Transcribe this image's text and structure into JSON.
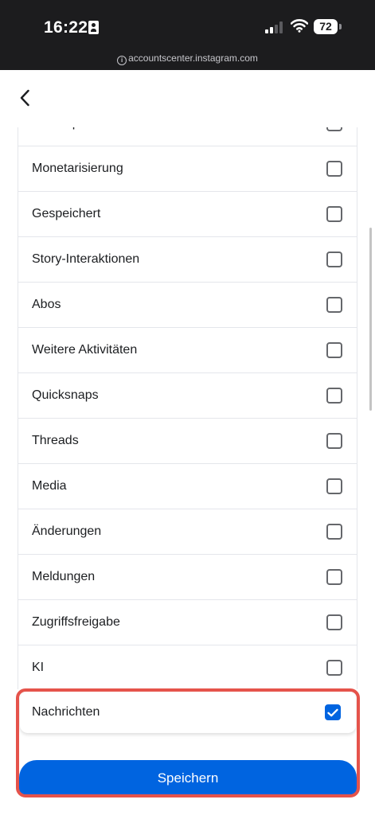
{
  "status_bar": {
    "time": "16:22",
    "battery": "72",
    "url": "accountscenter.instagram.com"
  },
  "list": {
    "items": [
      {
        "label": "Meta Spark",
        "checked": false
      },
      {
        "label": "Monetarisierung",
        "checked": false
      },
      {
        "label": "Gespeichert",
        "checked": false
      },
      {
        "label": "Story-Interaktionen",
        "checked": false
      },
      {
        "label": "Abos",
        "checked": false
      },
      {
        "label": "Weitere Aktivitäten",
        "checked": false
      },
      {
        "label": "Quicksnaps",
        "checked": false
      },
      {
        "label": "Threads",
        "checked": false
      },
      {
        "label": "Media",
        "checked": false
      },
      {
        "label": "Änderungen",
        "checked": false
      },
      {
        "label": "Meldungen",
        "checked": false
      },
      {
        "label": "Zugriffsfreigabe",
        "checked": false
      },
      {
        "label": "KI",
        "checked": false
      }
    ],
    "selected_item": {
      "label": "Nachrichten",
      "checked": true
    }
  },
  "footer": {
    "save_label": "Speichern"
  },
  "colors": {
    "accent": "#0064e0",
    "highlight": "#e5534b",
    "status_bar_bg": "#1c1c1e"
  }
}
